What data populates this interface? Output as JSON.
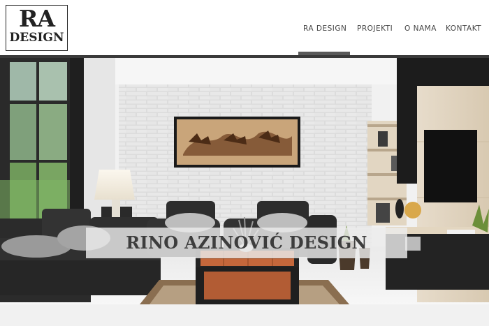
{
  "logo": {
    "line1": "RA",
    "line2": "DESIGN"
  },
  "nav": {
    "items": [
      {
        "label": "RA DESIGN",
        "active": true
      },
      {
        "label": "PROJEKTI",
        "active": false
      },
      {
        "label": "O NAMA",
        "active": false
      },
      {
        "label": "KONTAKT",
        "active": false
      }
    ]
  },
  "hero": {
    "title": "RINO AZINOVIĆ DESIGN"
  },
  "colors": {
    "accent_bar": "#3a3a3a",
    "active_indicator": "#5a5a5a",
    "banner_text": "#3d3d3d"
  }
}
